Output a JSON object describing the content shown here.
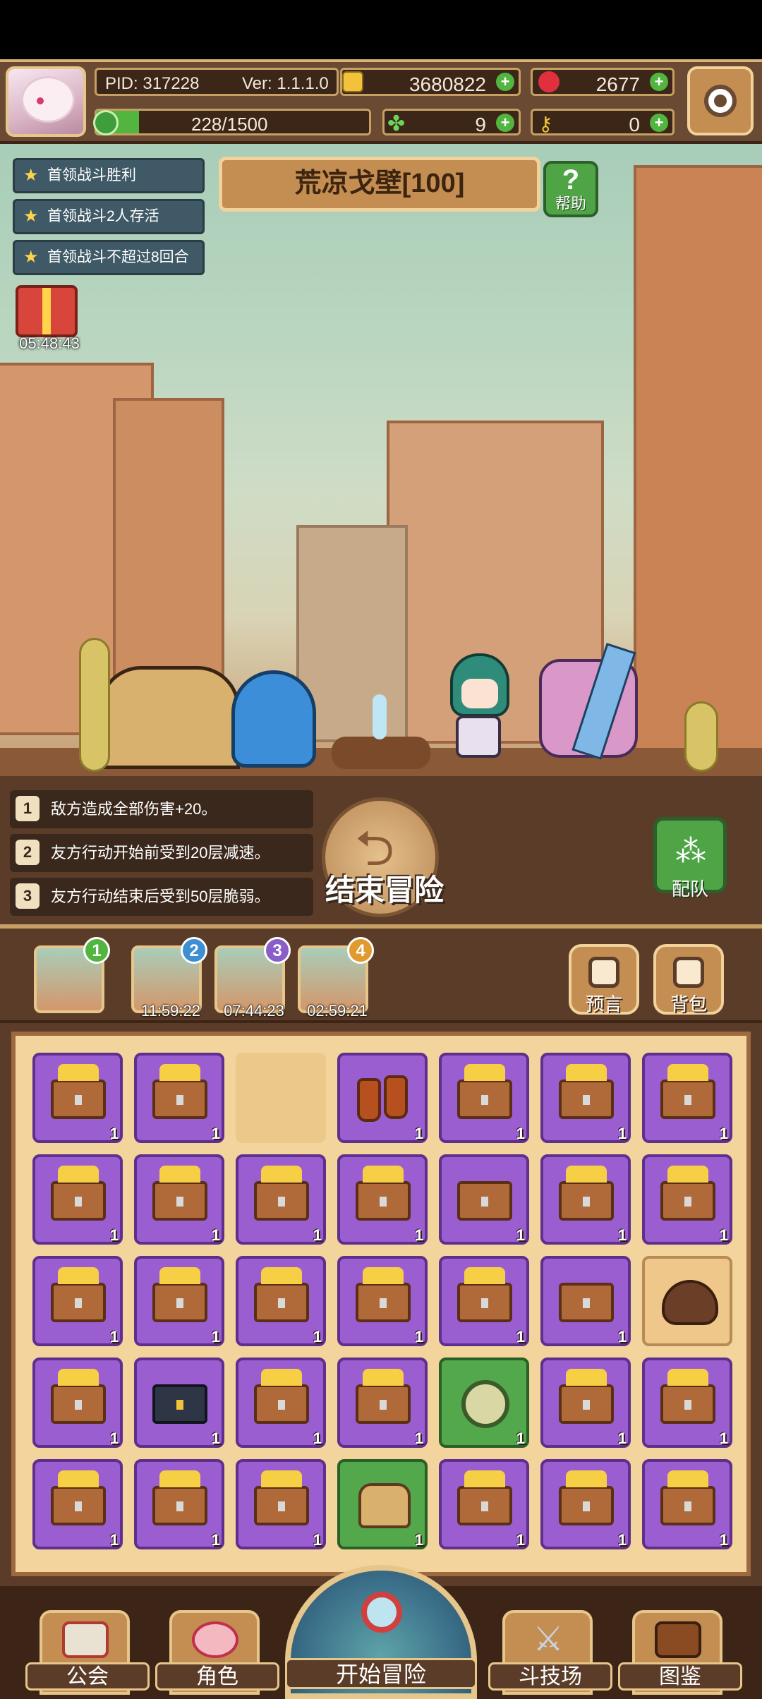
{
  "hud": {
    "pid": "PID: 317228",
    "version": "Ver: 1.1.1.0",
    "gold": "3680822",
    "gems": "2677",
    "energy": "228/1500",
    "clover": "9",
    "key": "0"
  },
  "stage": {
    "title": "荒凉戈壁[100]",
    "help": "帮助"
  },
  "quests": [
    "首领战斗胜利",
    "首领战斗2人存活",
    "首领战斗不超过8回合"
  ],
  "gift_timer": "05:48:43",
  "effects": [
    {
      "num": "1",
      "text": "敌方造成全部伤害+20。"
    },
    {
      "num": "2",
      "text": "友方行动开始前受到20层减速。"
    },
    {
      "num": "3",
      "text": "友方行动结束后受到50层脆弱。"
    }
  ],
  "buttons": {
    "end": "结束冒险",
    "team": "配队",
    "forecast": "预言",
    "bag": "背包"
  },
  "stages": [
    {
      "num": "1",
      "timer": "",
      "color": "#51b53f"
    },
    {
      "num": "2",
      "timer": "11:59:22",
      "color": "#3d8fd3"
    },
    {
      "num": "3",
      "timer": "07:44:23",
      "color": "#8a5ec9"
    },
    {
      "num": "4",
      "timer": "02:59:21",
      "color": "#e09a2f"
    }
  ],
  "inventory": [
    [
      "chest",
      "chest",
      "empty",
      "boots",
      "chest",
      "chest",
      "chest"
    ],
    [
      "chest",
      "chest",
      "chest",
      "chest",
      "plain",
      "chest",
      "chest"
    ],
    [
      "chest",
      "chest",
      "chest",
      "chest",
      "chest",
      "plain",
      "pot"
    ],
    [
      "chest",
      "dark",
      "chest",
      "chest",
      "coin",
      "chest",
      "chest"
    ],
    [
      "chest",
      "chest",
      "chest",
      "armor",
      "chest",
      "chest",
      "chest"
    ]
  ],
  "inventory_count": "1",
  "nav": {
    "guild": "公会",
    "role": "角色",
    "adventure": "开始冒险",
    "arena": "斗技场",
    "atlas": "图鉴"
  }
}
